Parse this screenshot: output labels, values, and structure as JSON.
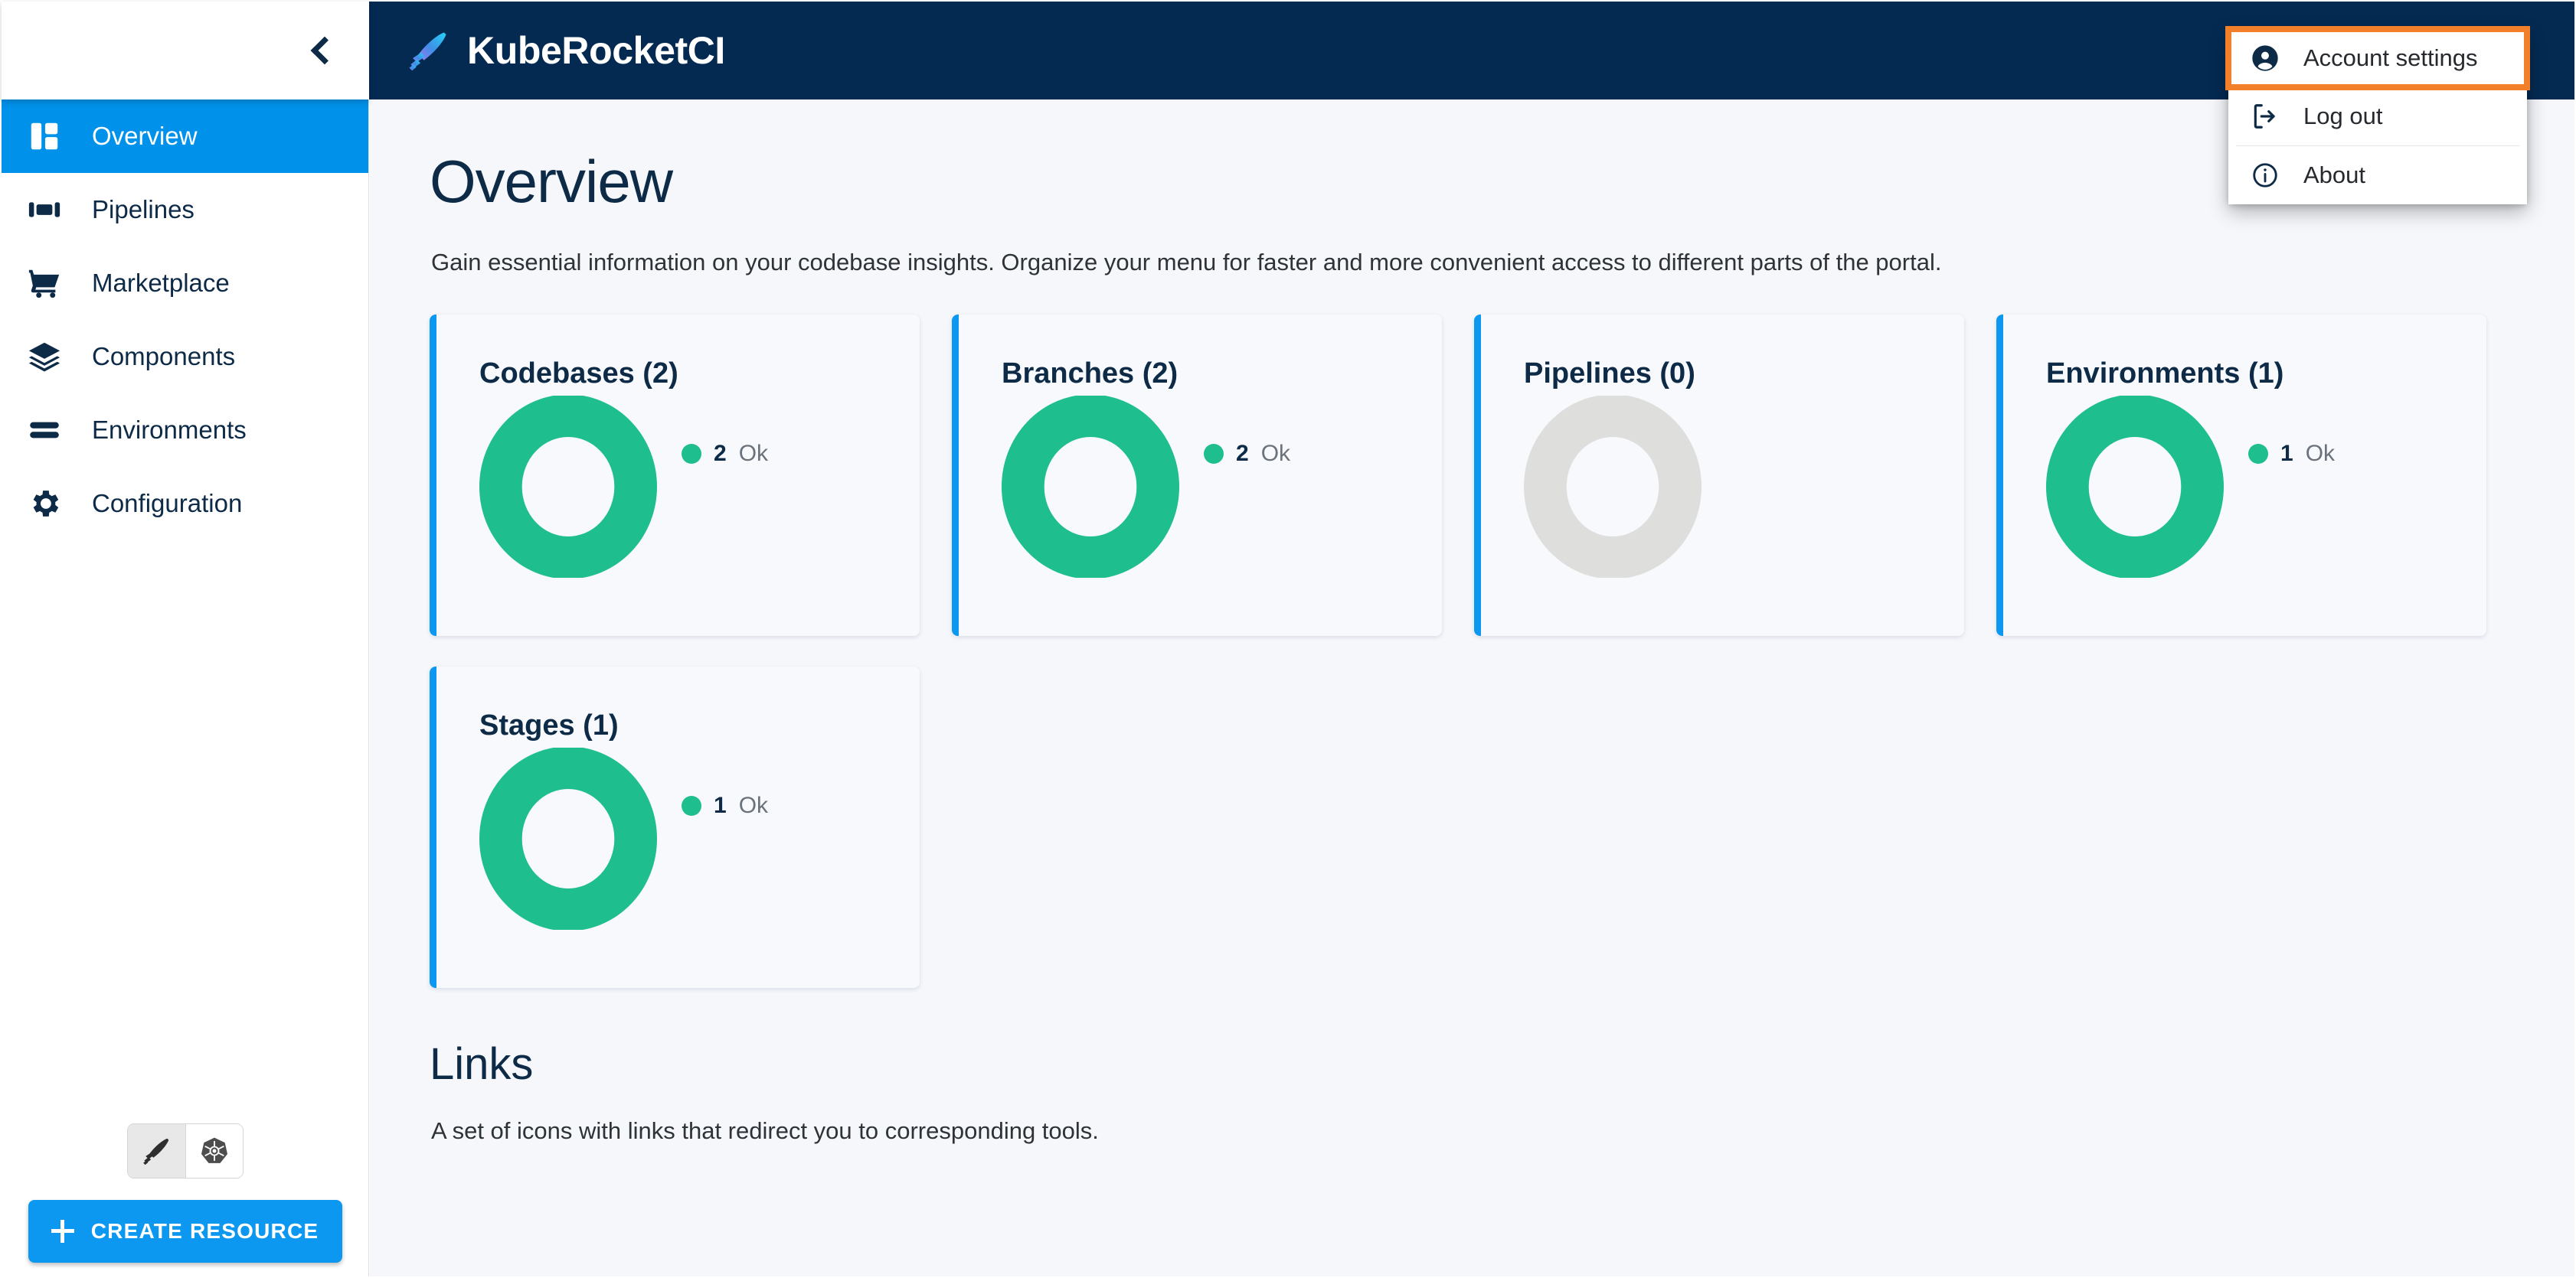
{
  "header": {
    "brand_title": "KubeRocketCI",
    "collapse_icon": "chevron-left-icon"
  },
  "account_menu": {
    "items": [
      {
        "label": "Account settings",
        "icon": "account-circle-icon",
        "highlighted": true
      },
      {
        "label": "Log out",
        "icon": "logout-icon",
        "highlighted": false
      },
      {
        "label": "About",
        "icon": "info-circle-icon",
        "highlighted": false
      }
    ],
    "highlight_color": "#f2802a"
  },
  "sidebar": {
    "items": [
      {
        "label": "Overview",
        "icon": "dashboard-icon",
        "active": true
      },
      {
        "label": "Pipelines",
        "icon": "pipelines-icon",
        "active": false
      },
      {
        "label": "Marketplace",
        "icon": "cart-icon",
        "active": false
      },
      {
        "label": "Components",
        "icon": "layers-icon",
        "active": false
      },
      {
        "label": "Environments",
        "icon": "server-stack-icon",
        "active": false
      },
      {
        "label": "Configuration",
        "icon": "gear-icon",
        "active": false
      }
    ],
    "view_toggle": [
      {
        "icon": "rocket-icon",
        "selected": true
      },
      {
        "icon": "kubernetes-icon",
        "selected": false
      }
    ],
    "create_button": {
      "label": "CREATE RESOURCE",
      "icon": "plus-icon",
      "color": "#0c98f0"
    }
  },
  "main": {
    "title": "Overview",
    "subtitle": "Gain essential information on your codebase insights. Organize your menu for faster and more convenient access to different parts of the portal.",
    "links_title": "Links",
    "links_subtitle": "A set of icons with links that redirect you to corresponding tools."
  },
  "chart_data": [
    {
      "type": "pie",
      "title": "Codebases (2)",
      "labels": [
        "Ok"
      ],
      "values": [
        2
      ],
      "total": 2,
      "colors": [
        "#1fbe8f"
      ],
      "legend": [
        {
          "count": "2",
          "label": "Ok",
          "color": "#1fbe8f"
        }
      ],
      "legend_position": "right",
      "empty": false
    },
    {
      "type": "pie",
      "title": "Branches (2)",
      "labels": [
        "Ok"
      ],
      "values": [
        2
      ],
      "total": 2,
      "colors": [
        "#1fbe8f"
      ],
      "legend": [
        {
          "count": "2",
          "label": "Ok",
          "color": "#1fbe8f"
        }
      ],
      "legend_position": "right",
      "empty": false
    },
    {
      "type": "pie",
      "title": "Pipelines (0)",
      "labels": [],
      "values": [],
      "total": 0,
      "colors": [
        "#dededc"
      ],
      "legend": [],
      "legend_position": "right",
      "empty": true
    },
    {
      "type": "pie",
      "title": "Environments (1)",
      "labels": [
        "Ok"
      ],
      "values": [
        1
      ],
      "total": 1,
      "colors": [
        "#1fbe8f"
      ],
      "legend": [
        {
          "count": "1",
          "label": "Ok",
          "color": "#1fbe8f"
        }
      ],
      "legend_position": "right",
      "empty": false
    },
    {
      "type": "pie",
      "title": "Stages (1)",
      "labels": [
        "Ok"
      ],
      "values": [
        1
      ],
      "total": 1,
      "colors": [
        "#1fbe8f"
      ],
      "legend": [
        {
          "count": "1",
          "label": "Ok",
          "color": "#1fbe8f"
        }
      ],
      "legend_position": "right",
      "empty": false
    }
  ],
  "colors": {
    "appbar": "#042a52",
    "accent_blue": "#0091ea",
    "status_ok": "#1fbe8f",
    "status_empty": "#dededc",
    "highlight_orange": "#f2802a",
    "content_bg": "#f5f7fb"
  }
}
